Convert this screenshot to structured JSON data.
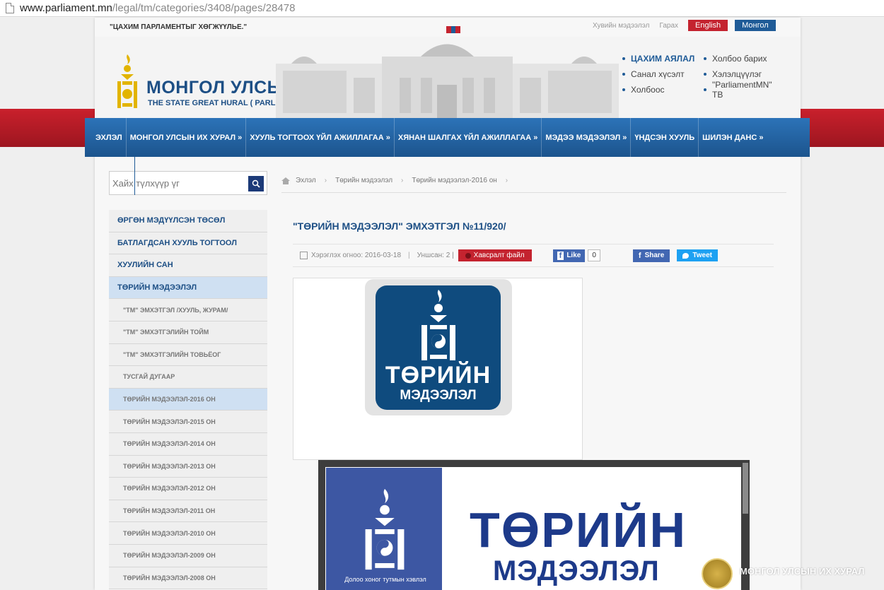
{
  "browser": {
    "url_host": "www.parliament.mn",
    "url_path": "/legal/tm/categories/3408/pages/28478"
  },
  "topbar": {
    "slogan": "\"ЦАХИМ ПАРЛАМЕНТЫГ ХӨГЖҮҮЛЬЕ.\"",
    "links": [
      "Хувийн мэдээлэл",
      "Гарах"
    ],
    "lang_english": "English",
    "lang_mongol": "Монгол"
  },
  "header": {
    "title": "МОНГОЛ УЛСЫН ИХ ХУРАЛ",
    "subtitle": "THE STATE GREAT HURAL ( PARLIAMENT ) OF MONGOLIA",
    "links": [
      [
        "ЦАХИМ АЯЛАЛ",
        "Холбоо барих"
      ],
      [
        "Санал хүсэлт",
        "Хэлэлцүүлэг"
      ],
      [
        "Холбоос",
        "\"ParliamentMN\" ТВ"
      ]
    ]
  },
  "nav": {
    "items": [
      "ЭХЛЭЛ",
      "МОНГОЛ УЛСЫН ИХ ХУРАЛ »",
      "ХУУЛЬ ТОГТООХ ҮЙЛ АЖИЛЛАГАА »",
      "ХЯНАН ШАЛГАХ ҮЙЛ АЖИЛЛАГАА »",
      "МЭДЭЭ МЭДЭЭЛЭЛ »",
      "ҮНДСЭН ХУУЛЬ",
      "ШИЛЭН ДАНС »"
    ]
  },
  "search": {
    "placeholder": "Хайх түлхүүр үг"
  },
  "sidebar": {
    "items": [
      {
        "label": "ӨРГӨН МЭДҮҮЛСЭН ТӨСӨЛ",
        "sub": false,
        "active": false
      },
      {
        "label": "БАТЛАГДСАН ХУУЛЬ ТОГТООЛ",
        "sub": false,
        "active": false
      },
      {
        "label": "ХУУЛИЙН САН",
        "sub": false,
        "active": false
      },
      {
        "label": "ТӨРИЙН МЭДЭЭЛЭЛ",
        "sub": false,
        "active": true
      },
      {
        "label": "\"ТМ\" ЭМХЭТГЭЛ /ХУУЛЬ, ЖУРАМ/",
        "sub": true,
        "active": false
      },
      {
        "label": "\"ТМ\" ЭМХЭТГЭЛИЙН ТОЙМ",
        "sub": true,
        "active": false
      },
      {
        "label": "\"ТМ\" ЭМХЭТГЭЛИЙН ТОВЬЁОГ",
        "sub": true,
        "active": false
      },
      {
        "label": "ТУСГАЙ ДУГААР",
        "sub": true,
        "active": false
      },
      {
        "label": "ТӨРИЙН МЭДЭЭЛЭЛ-2016 ОН",
        "sub": true,
        "active": true
      },
      {
        "label": "ТӨРИЙН МЭДЭЭЛЭЛ-2015 ОН",
        "sub": true,
        "active": false
      },
      {
        "label": "ТӨРИЙН МЭДЭЭЛЭЛ-2014 ОН",
        "sub": true,
        "active": false
      },
      {
        "label": "ТӨРИЙН МЭДЭЭЛЭЛ-2013 ОН",
        "sub": true,
        "active": false
      },
      {
        "label": "ТӨРИЙН МЭДЭЭЛЭЛ-2012 ОН",
        "sub": true,
        "active": false
      },
      {
        "label": "ТӨРИЙН МЭДЭЭЛЭЛ-2011 ОН",
        "sub": true,
        "active": false
      },
      {
        "label": "ТӨРИЙН МЭДЭЭЛЭЛ-2010 ОН",
        "sub": true,
        "active": false
      },
      {
        "label": "ТӨРИЙН МЭДЭЭЛЭЛ-2009 ОН",
        "sub": true,
        "active": false
      },
      {
        "label": "ТӨРИЙН МЭДЭЭЛЭЛ-2008 ОН",
        "sub": true,
        "active": false
      }
    ]
  },
  "breadcrumb": {
    "home": "Эхлэл",
    "level1": "Төрийн мэдээлэл",
    "level2": "Төрийн мэдээлэл-2016 он"
  },
  "article": {
    "title": "\"ТӨРИЙН МЭДЭЭЛЭЛ\" ЭМХЭТГЭЛ №11/920/",
    "published": "Хэрэглэх огноо: 2016-03-18",
    "views": "Уншсан: 2 |",
    "pdf_button": "Хавсралт файл",
    "fb_like": "Like",
    "fb_count": "0",
    "fb_share": "Share",
    "tweet": "Tweet"
  },
  "cover1": {
    "big": "ТӨРИЙН",
    "small": "МЭДЭЭЛЭЛ"
  },
  "cover2": {
    "big": "ТӨРИЙН",
    "small": "МЭДЭЭЛЭЛ",
    "caption": "Долоо хоног тутмын хэвлэл"
  },
  "watermark": {
    "text": "МОНГОЛ УЛСЫН ИХ ХУРАЛ"
  },
  "colors": {
    "brand_blue": "#1d4f85",
    "nav_blue": "#1c548d",
    "accent_red": "#c4232f"
  }
}
